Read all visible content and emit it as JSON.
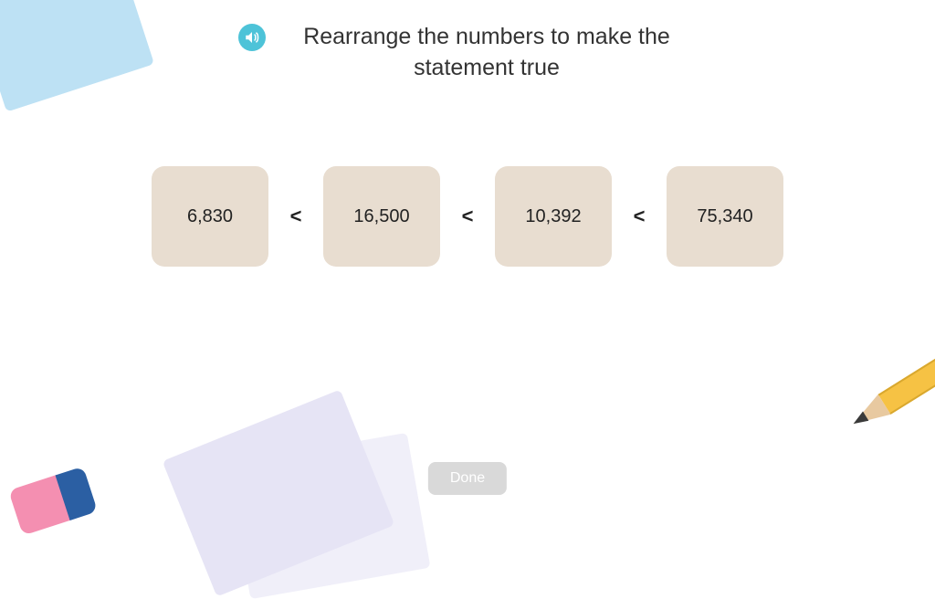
{
  "header": {
    "title": "Rearrange the numbers to make the statement true"
  },
  "tiles": [
    "6,830",
    "16,500",
    "10,392",
    "75,340"
  ],
  "operator": "<",
  "buttons": {
    "done": "Done"
  }
}
